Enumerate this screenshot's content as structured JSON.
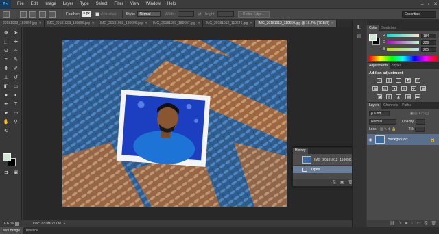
{
  "app": {
    "logo": "Ps"
  },
  "menu": [
    "File",
    "Edit",
    "Image",
    "Layer",
    "Type",
    "Select",
    "Filter",
    "View",
    "Window",
    "Help"
  ],
  "window_controls": [
    "–",
    "▫",
    "✕"
  ],
  "options": {
    "feather_label": "Feather:",
    "feather_value": "0 px",
    "antialias_label": "Anti-alias",
    "style_label": "Style:",
    "style_value": "Normal",
    "width_label": "Width:",
    "height_label": "Height:",
    "refine_label": "Refine Edge...",
    "workspace": "Essentials"
  },
  "tabs": [
    {
      "label": "20181003_180554.jpg",
      "active": false
    },
    {
      "label": "IMG_20181003_180556.jpg",
      "active": false
    },
    {
      "label": "IMG_20181003_180606.jpg",
      "active": false
    },
    {
      "label": "IMG_20181003_180607.jpg",
      "active": false
    },
    {
      "label": "IMG_20181012_110646.jpg",
      "active": false
    },
    {
      "label": "IMG_20181012_110650.jpg @ 16.7% (RGB/8)",
      "active": true
    }
  ],
  "tab_close": "✕",
  "status": {
    "zoom": "16.67%",
    "doc": "Doc: 27.0M/27.0M",
    "arrow": "▸"
  },
  "bottom_tabs": [
    {
      "label": "Mini Bridge",
      "active": true
    },
    {
      "label": "Timeline",
      "active": false
    }
  ],
  "color_panel": {
    "tabs": [
      {
        "label": "Color",
        "active": true
      },
      {
        "label": "Swatches",
        "active": false
      }
    ],
    "fg_color": "#cfe7d4",
    "bg_color": "#000000",
    "r_label": "R",
    "r_value": "184",
    "g_label": "G",
    "g_value": "226",
    "b_label": "B",
    "b_value": "205"
  },
  "adjustments_panel": {
    "tabs": [
      {
        "label": "Adjustments",
        "active": true
      },
      {
        "label": "Styles",
        "active": false
      }
    ],
    "title": "Add an adjustment"
  },
  "layers_panel": {
    "tabs": [
      {
        "label": "Layers",
        "active": true
      },
      {
        "label": "Channels",
        "active": false
      },
      {
        "label": "Paths",
        "active": false
      }
    ],
    "kind_label": "ρ Kind",
    "blend_mode": "Normal",
    "opacity_label": "Opacity:",
    "lock_label": "Lock:",
    "fill_label": "Fill:",
    "layer_name": "Background"
  },
  "history_panel": {
    "tabs": [
      {
        "label": "History",
        "active": true
      }
    ],
    "snapshot": "IMG_20181012_110650...",
    "state": "Open"
  }
}
